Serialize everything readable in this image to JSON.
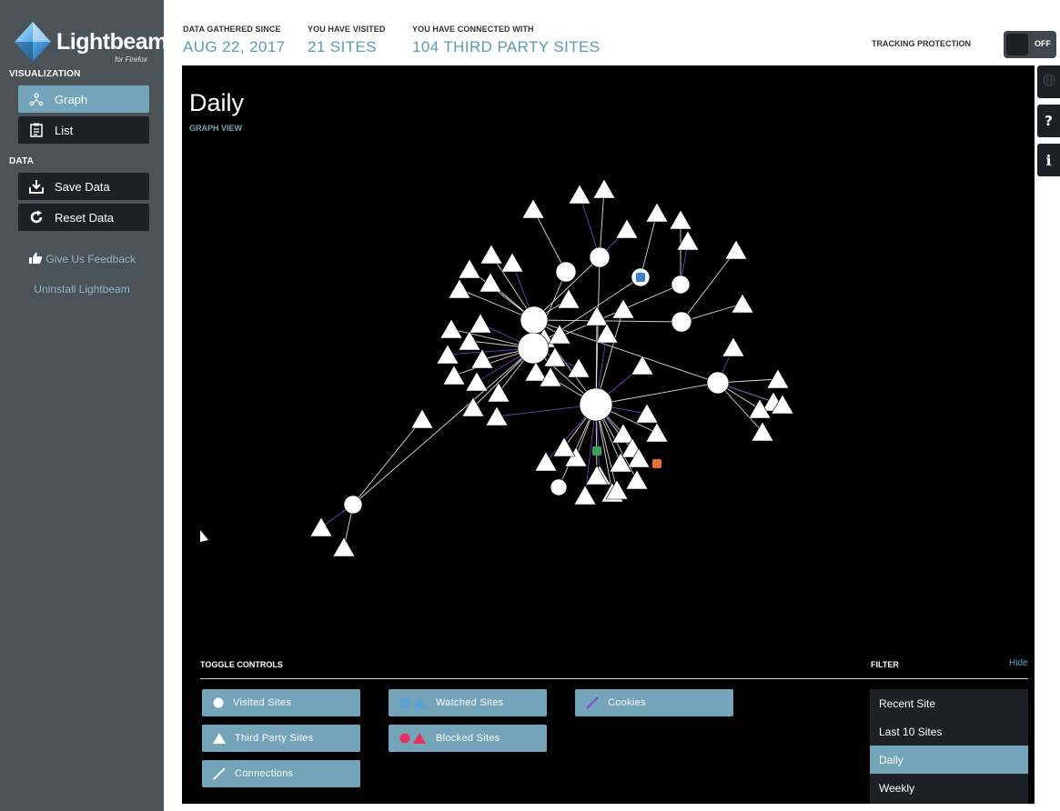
{
  "app": {
    "logo_text": "Lightbeam",
    "logo_sub": "for Firefox"
  },
  "sidebar": {
    "visualization_label": "VISUALIZATION",
    "graph_label": "Graph",
    "list_label": "List",
    "data_label": "DATA",
    "save_label": "Save Data",
    "reset_label": "Reset Data",
    "feedback_label": "Give Us Feedback",
    "uninstall_label": "Uninstall Lightbeam"
  },
  "header": {
    "gathered_label": "DATA GATHERED SINCE",
    "gathered_value": "AUG 22, 2017",
    "visited_label": "YOU HAVE VISITED",
    "visited_value": "21 SITES",
    "connected_label": "YOU HAVE CONNECTED WITH",
    "connected_value": "104 THIRD PARTY SITES",
    "tracking_label": "TRACKING PROTECTION",
    "tracking_state": "OFF"
  },
  "main": {
    "title": "Daily",
    "subtitle": "GRAPH VIEW"
  },
  "controls": {
    "toggle_label": "TOGGLE CONTROLS",
    "filter_label": "FILTER",
    "hide_label": "Hide",
    "visited_sites": "Visited Sites",
    "third_party_sites": "Third Party Sites",
    "connections": "Connections",
    "watched_sites": "Watched Sites",
    "blocked_sites": "Blocked Sites",
    "cookies": "Cookies"
  },
  "filter": {
    "items": [
      "Recent Site",
      "Last 10 Sites",
      "Daily",
      "Weekly"
    ],
    "selected": "Daily"
  },
  "colors": {
    "accent": "#73a4b9",
    "sidebar": "#4b5258",
    "button_dark": "#1d2024",
    "watched": "#5aa2d6",
    "blocked": "#e2355e",
    "cookie_link": "#7e4fc8"
  },
  "icons": {
    "graph": "graph-icon",
    "list": "list-icon",
    "save": "download-icon",
    "reset": "refresh-icon",
    "feedback": "thumbs-up-icon",
    "globe": "globe-icon",
    "help": "question-icon",
    "info": "info-icon"
  }
}
